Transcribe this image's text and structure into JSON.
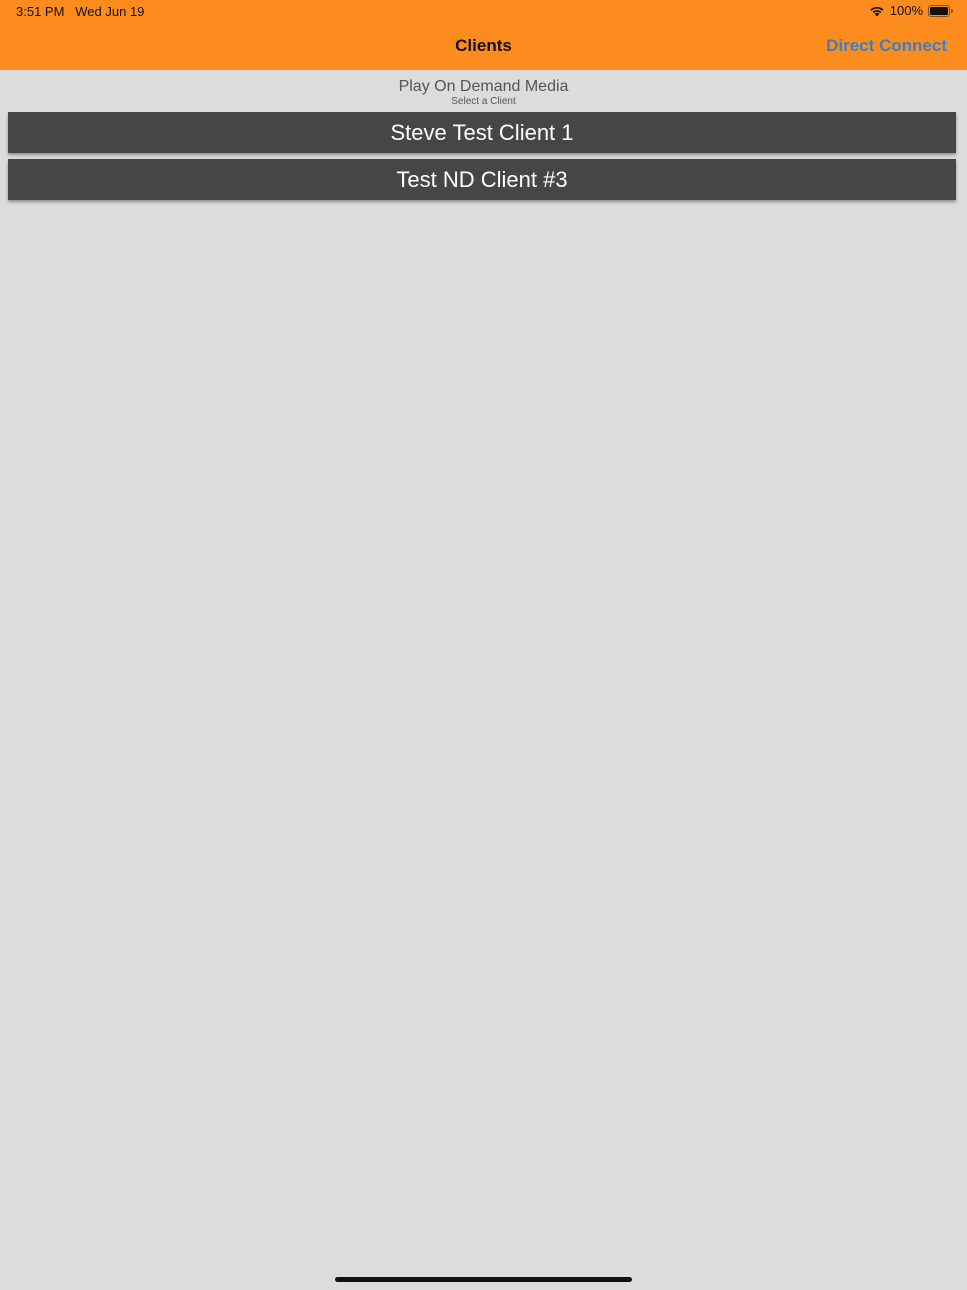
{
  "status_bar": {
    "time": "3:51 PM",
    "date": "Wed Jun 19",
    "battery": "100%",
    "icons": [
      "wifi-icon",
      "battery-icon"
    ]
  },
  "nav": {
    "title": "Clients",
    "right_action": "Direct Connect"
  },
  "content": {
    "heading": "Play On Demand Media",
    "subheading": "Select a Client",
    "clients": [
      {
        "label": "Steve Test Client 1"
      },
      {
        "label": "Test ND Client #3"
      }
    ]
  },
  "colors": {
    "accent": "#fd8c1e",
    "link": "#3d7fc2",
    "button_bg": "#464646",
    "background": "#dcdcdc"
  }
}
